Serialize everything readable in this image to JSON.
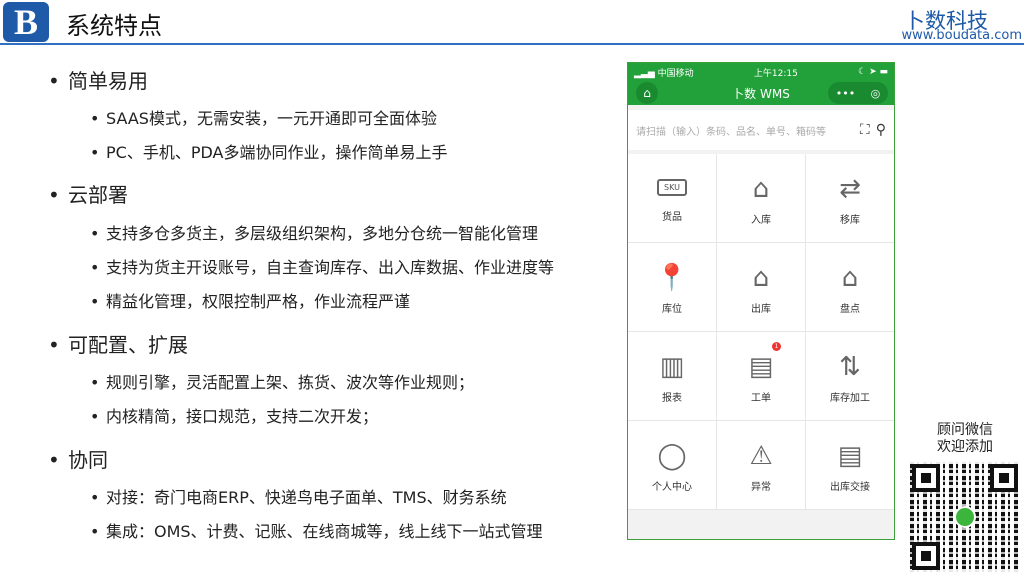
{
  "header": {
    "logo": "B",
    "title": "系统特点",
    "brand": "卜数科技",
    "url": "www.boudata.com"
  },
  "bullet": "•",
  "sections": [
    {
      "title": "简单易用",
      "items": [
        "SAAS模式，无需安装，一元开通即可全面体验",
        "PC、手机、PDA多端协同作业，操作简单易上手"
      ]
    },
    {
      "title": "云部署",
      "items": [
        "支持多仓多货主，多层级组织架构，多地分仓统一智能化管理",
        "支持为货主开设账号，自主查询库存、出入库数据、作业进度等",
        "精益化管理，权限控制严格，作业流程严谨"
      ]
    },
    {
      "title": "可配置、扩展",
      "items": [
        "规则引擎，灵活配置上架、拣货、波次等作业规则；",
        "内核精简，接口规范，支持二次开发；"
      ]
    },
    {
      "title": "协同",
      "items": [
        "对接：奇门电商ERP、快递鸟电子面单、TMS、财务系统",
        "集成：OMS、计费、记账、在线商城等，线上线下一站式管理"
      ]
    }
  ],
  "phone": {
    "carrier": "中国移动",
    "time": "上午12:15",
    "app_title": "卜数 WMS",
    "more": "•••",
    "target": "◎",
    "search_placeholder": "请扫描（输入）条码、品名、单号、箱码等",
    "sku": "SKU",
    "badge": "1",
    "tiles": [
      "货品",
      "入库",
      "移库",
      "库位",
      "出库",
      "盘点",
      "报表",
      "工单",
      "库存加工",
      "个人中心",
      "异常",
      "出库交接"
    ]
  },
  "qr": {
    "line1": "顾问微信",
    "line2": "欢迎添加"
  },
  "colors": {
    "brand": "#1e5aa8",
    "app_green": "#22a03a"
  }
}
